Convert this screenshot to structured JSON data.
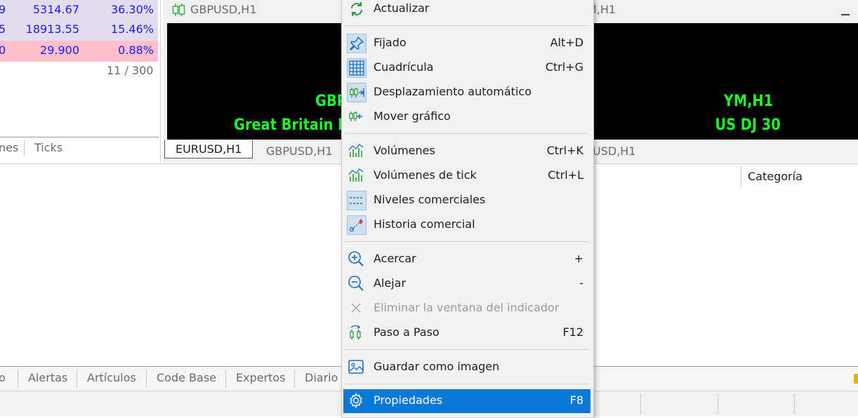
{
  "market_watch": {
    "rows": [
      {
        "c1": "9",
        "c2": "5314.67",
        "c3": "36.30%",
        "bg": "#e3dcef"
      },
      {
        "c1": "5",
        "c2": "18913.55",
        "c3": "15.46%",
        "bg": "#e3dcef"
      },
      {
        "c1": "0",
        "c2": "29.900",
        "c3": "0.88%",
        "bg": "#ffc0cb"
      }
    ],
    "count": "11 / 300",
    "tabs": [
      "nes",
      "Ticks"
    ]
  },
  "charts": {
    "gbpusd_title": "GBPUSD,H1",
    "ym_title": "M,H1",
    "gbp_label_line1": "GBP",
    "gbp_label_line2": "Great Britain P",
    "ym_label_line1": "YM,H1",
    "ym_label_line2": "US DJ 30",
    "tabs": [
      "EURUSD,H1",
      "GBPUSD,H1",
      "USD,H1"
    ]
  },
  "toolbox": {
    "column_header": "Categoría",
    "tabs": [
      "o",
      "Alertas",
      "Artículos",
      "Code Base",
      "Expertos",
      "Diario"
    ]
  },
  "context_menu": {
    "items": [
      {
        "label": "Actualizar",
        "shortcut": ""
      },
      {
        "label": "Fijado",
        "shortcut": "Alt+D"
      },
      {
        "label": "Cuadrícula",
        "shortcut": "Ctrl+G"
      },
      {
        "label": "Desplazamiento automático",
        "shortcut": ""
      },
      {
        "label": "Mover gráfico",
        "shortcut": ""
      },
      {
        "label": "Volúmenes",
        "shortcut": "Ctrl+K"
      },
      {
        "label": "Volúmenes de tick",
        "shortcut": "Ctrl+L"
      },
      {
        "label": "Niveles comerciales",
        "shortcut": ""
      },
      {
        "label": "Historia comercial",
        "shortcut": ""
      },
      {
        "label": "Acercar",
        "shortcut": "+"
      },
      {
        "label": "Alejar",
        "shortcut": "-"
      },
      {
        "label": "Eliminar la ventana del indicador",
        "shortcut": ""
      },
      {
        "label": "Paso a Paso",
        "shortcut": "F12"
      },
      {
        "label": "Guardar como imagen",
        "shortcut": ""
      },
      {
        "label": "Propiedades",
        "shortcut": "F8"
      }
    ]
  },
  "colors": {
    "accent": "#0a78d7",
    "chart_text": "#1bff2a",
    "positive": "#1a1aff",
    "negative_bg": "#ffc0cb"
  }
}
